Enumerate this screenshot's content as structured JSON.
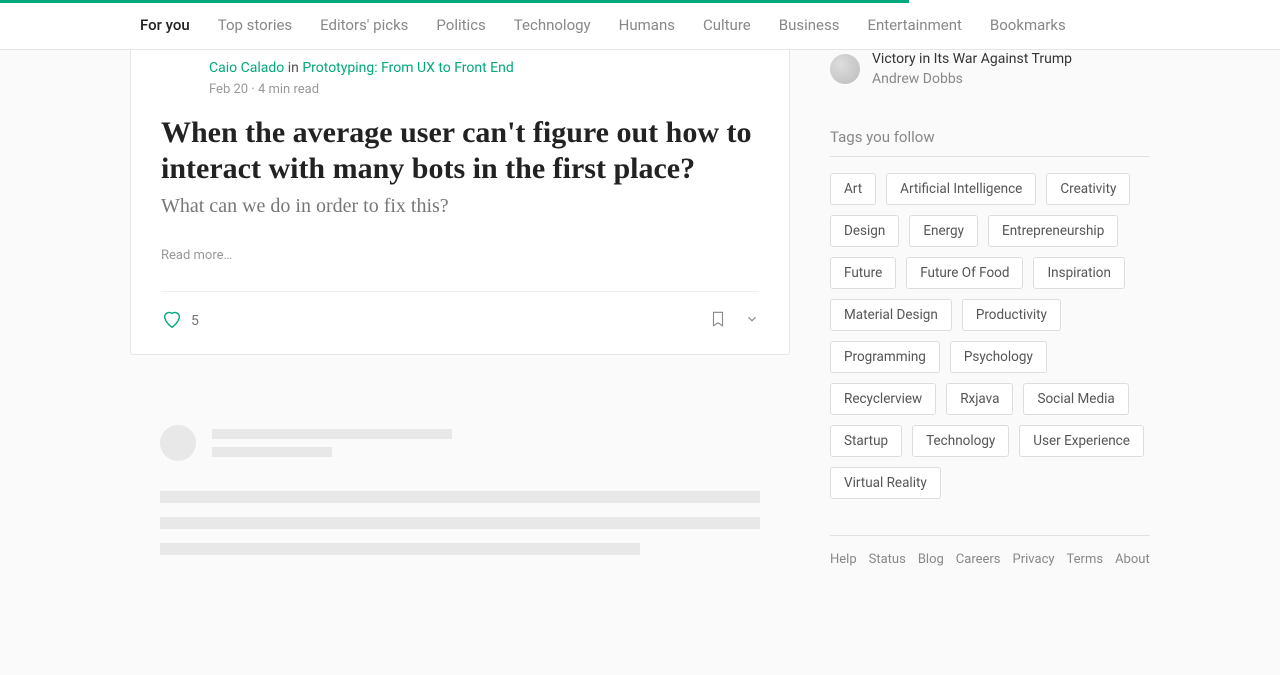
{
  "nav": {
    "items": [
      {
        "label": "For you",
        "active": true
      },
      {
        "label": "Top stories"
      },
      {
        "label": "Editors' picks"
      },
      {
        "label": "Politics"
      },
      {
        "label": "Technology"
      },
      {
        "label": "Humans"
      },
      {
        "label": "Culture"
      },
      {
        "label": "Business"
      },
      {
        "label": "Entertainment"
      },
      {
        "label": "Bookmarks"
      }
    ]
  },
  "article": {
    "author": "Caio Calado",
    "in_word": "in",
    "publication": "Prototyping: From UX to Front End",
    "date": "Feb 20",
    "read_time": "4 min read",
    "title": "When the average user can't figure out how to interact with many bots in the first place?",
    "subtitle": "What can we do in order to fix this?",
    "read_more": "Read more…",
    "likes": "5"
  },
  "recommendation": {
    "title": "Victory in Its War Against Trump",
    "author": "Andrew Dobbs"
  },
  "tags_section": {
    "header": "Tags you follow",
    "tags": [
      "Art",
      "Artificial Intelligence",
      "Creativity",
      "Design",
      "Energy",
      "Entrepreneurship",
      "Future",
      "Future Of Food",
      "Inspiration",
      "Material Design",
      "Productivity",
      "Programming",
      "Psychology",
      "Recyclerview",
      "Rxjava",
      "Social Media",
      "Startup",
      "Technology",
      "User Experience",
      "Virtual Reality"
    ]
  },
  "footer": {
    "links": [
      "Help",
      "Status",
      "Blog",
      "Careers",
      "Privacy",
      "Terms",
      "About"
    ]
  }
}
